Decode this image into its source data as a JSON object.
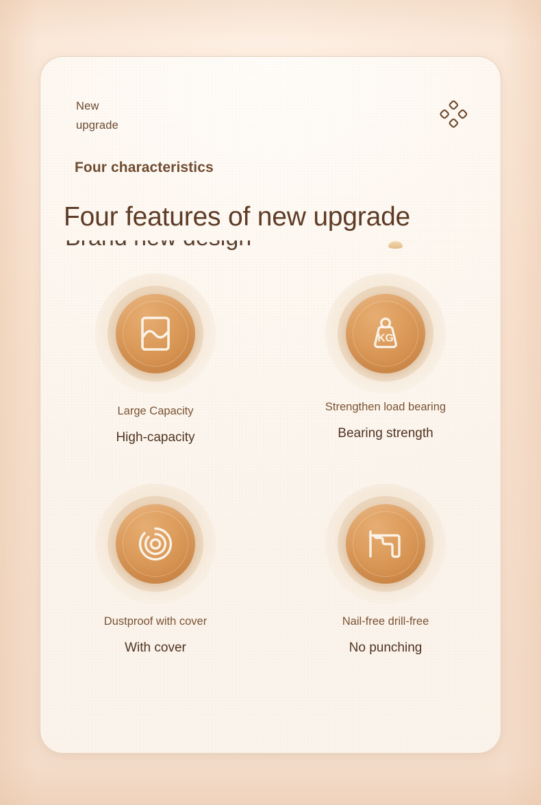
{
  "header": {
    "eyebrow_line1": "New",
    "eyebrow_line2": "upgrade",
    "ornament_icon": "four-diamond-ornament-icon",
    "subtitle": "Four characteristics",
    "title": "Four features of new upgrade",
    "clipped_line": "Brand new design",
    "accent_dot": "tan-blob-dot"
  },
  "features": [
    {
      "icon": "container-capacity-icon",
      "label_top": "Large Capacity",
      "label_bottom": "High-capacity"
    },
    {
      "icon": "kg-weight-icon",
      "label_top": "Strengthen load bearing",
      "label_bottom": "Bearing strength"
    },
    {
      "icon": "concentric-circles-cover-icon",
      "label_top": "Dustproof with cover",
      "label_bottom": "With cover"
    },
    {
      "icon": "drill-icon",
      "label_top": "Nail-free drill-free",
      "label_bottom": "No punching"
    }
  ],
  "colors": {
    "page_background": "#f6e1cf",
    "card_background": "#fdf8f1",
    "disc_orange": "#d9954f",
    "disc_orange_dark": "#c9823f",
    "title_brown": "#5d3b26",
    "subtitle_brown": "#6f4b31",
    "label_top_brown": "#7a5233",
    "label_bottom_brown": "#4f3320",
    "halo_tan": "#e2c19e"
  }
}
